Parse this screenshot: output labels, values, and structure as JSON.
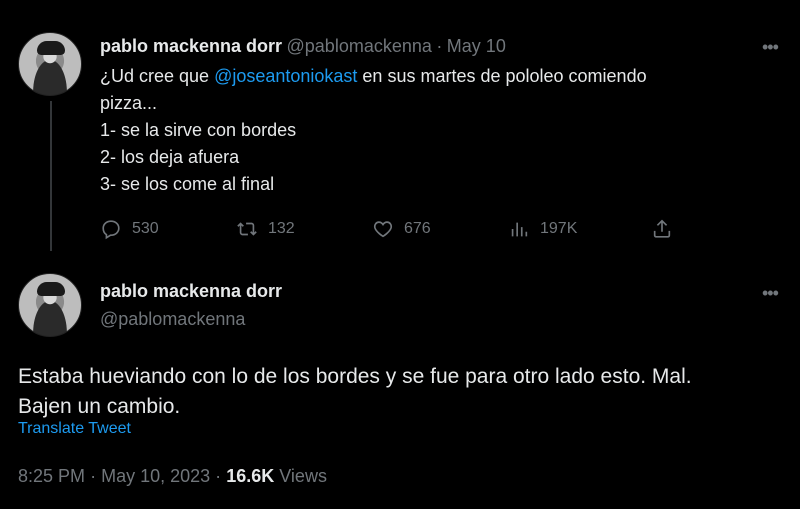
{
  "reply_tweet": {
    "display_name": "pablo mackenna dorr",
    "handle": "@pablomackenna",
    "separator": "·",
    "date": "May 10",
    "more_label": "•••",
    "text_lines": [
      {
        "before": "¿Ud cree que ",
        "mention": "@joseantoniokast",
        "after": " en sus martes de pololeo comiendo"
      },
      {
        "text": "pizza..."
      },
      {
        "text": "1- se la sirve con bordes"
      },
      {
        "text": "2- los deja afuera"
      },
      {
        "text": "3- se los come al final"
      }
    ],
    "actions": {
      "replies": "530",
      "retweets": "132",
      "likes": "676",
      "views": "197K"
    }
  },
  "main_tweet": {
    "display_name": "pablo mackenna dorr",
    "handle": "@pablomackenna",
    "more_label": "•••",
    "text_lines": [
      "Estaba hueviando con lo de los bordes y se fue para otro lado esto. Mal.",
      "Bajen un cambio."
    ],
    "translate_label": "Translate Tweet",
    "time": "8:25 PM",
    "separator": "·",
    "full_date": "May 10, 2023",
    "views_count": "16.6K",
    "views_label": "Views"
  },
  "colors": {
    "background": "#000000",
    "text": "#e7e9ea",
    "secondary": "#71767b",
    "accent": "#1d9bf0"
  }
}
